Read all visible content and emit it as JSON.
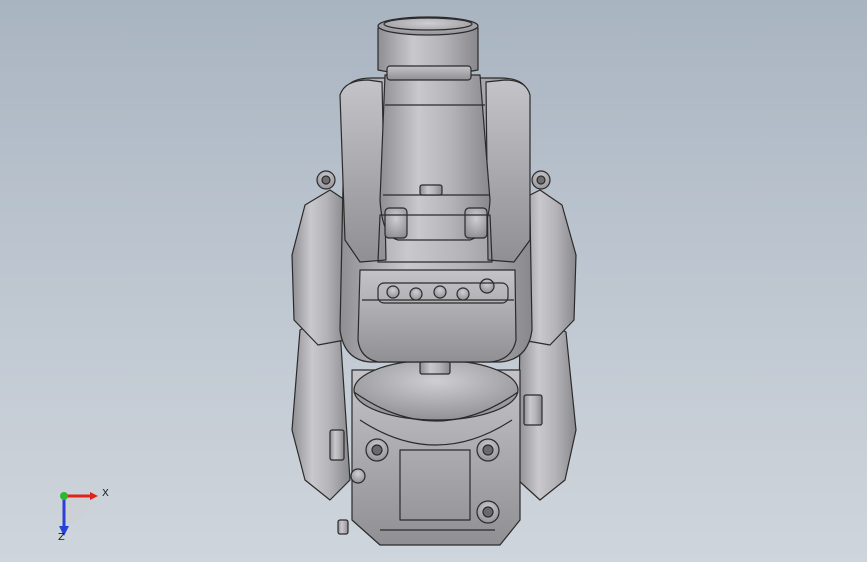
{
  "viewport": {
    "background_top": "#a9b4c1",
    "background_bottom": "#cfd5dc"
  },
  "model": {
    "body_color": "#a8a8ac",
    "edge_color": "#2b2b2b",
    "highlight_color": "#d8d8dc"
  },
  "triad": {
    "x_label": "X",
    "z_label": "Z",
    "x_color": "#e0241b",
    "y_color": "#2fb82f",
    "z_color": "#2a3fd8"
  }
}
